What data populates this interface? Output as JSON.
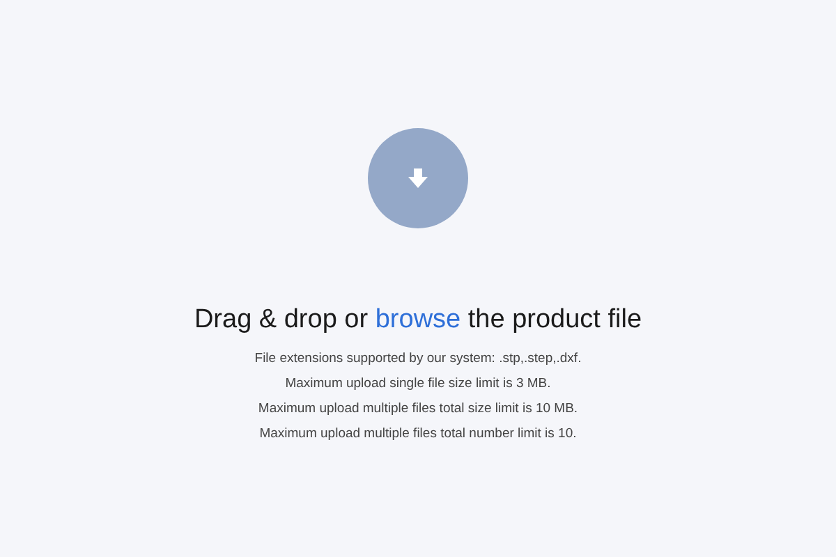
{
  "upload": {
    "heading": {
      "before": "Drag & drop or",
      "link": "browse",
      "after": "the product file"
    },
    "notes": [
      "File extensions supported by our system: .stp,.step,.dxf.",
      "Maximum upload single file size limit is 3 MB.",
      "Maximum upload multiple files total size limit is 10 MB.",
      "Maximum upload multiple files total number limit is 10."
    ]
  }
}
